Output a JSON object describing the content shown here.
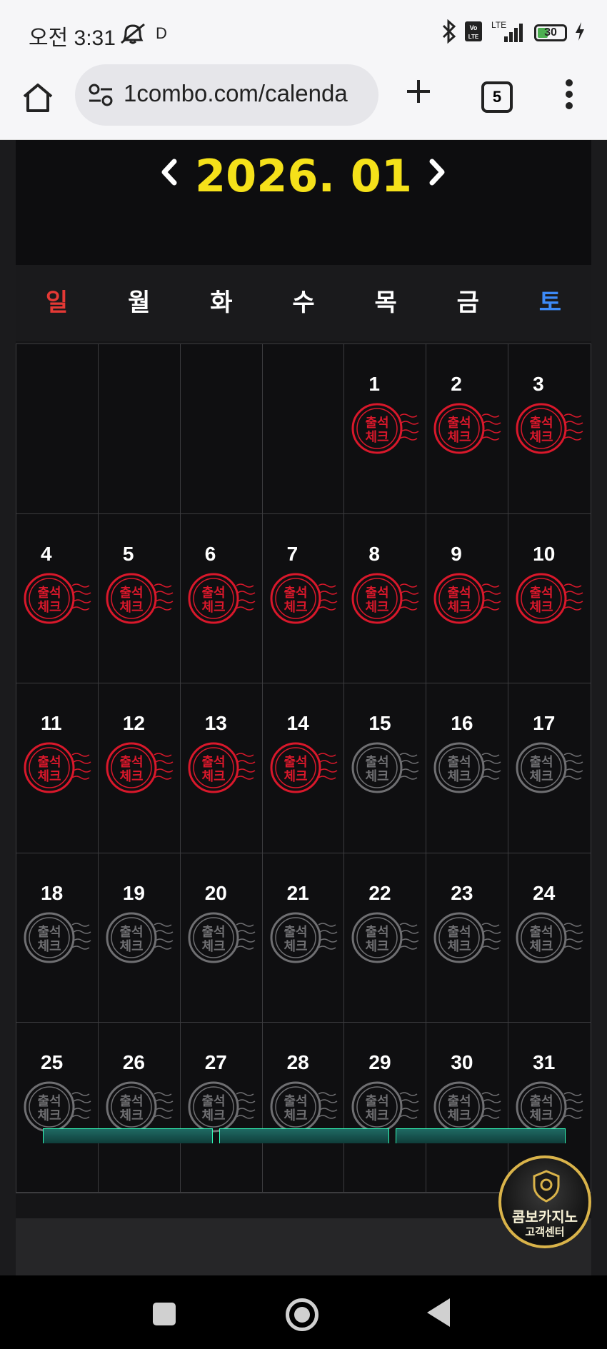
{
  "status_bar": {
    "time": "오전 3:31",
    "indicator": "D",
    "battery": "30"
  },
  "browser": {
    "url": "1combo.com/calenda",
    "tab_count": "5"
  },
  "calendar": {
    "title": "2026. 01",
    "weekdays": [
      "일",
      "월",
      "화",
      "수",
      "목",
      "금",
      "토"
    ],
    "first_weekday_index": 4,
    "days_in_month": 31,
    "checked_through_day": 14,
    "stamp_text": [
      "출석",
      "체크"
    ],
    "stamp_color_checked": "#d9182b",
    "stamp_color_unchecked": "#6f6f72"
  },
  "support_badge": {
    "line1": "콤보카지노",
    "line2": "고객센터"
  },
  "colors": {
    "title_yellow": "#f5e11a",
    "sunday_red": "#e53935",
    "saturday_blue": "#3d8af7"
  }
}
